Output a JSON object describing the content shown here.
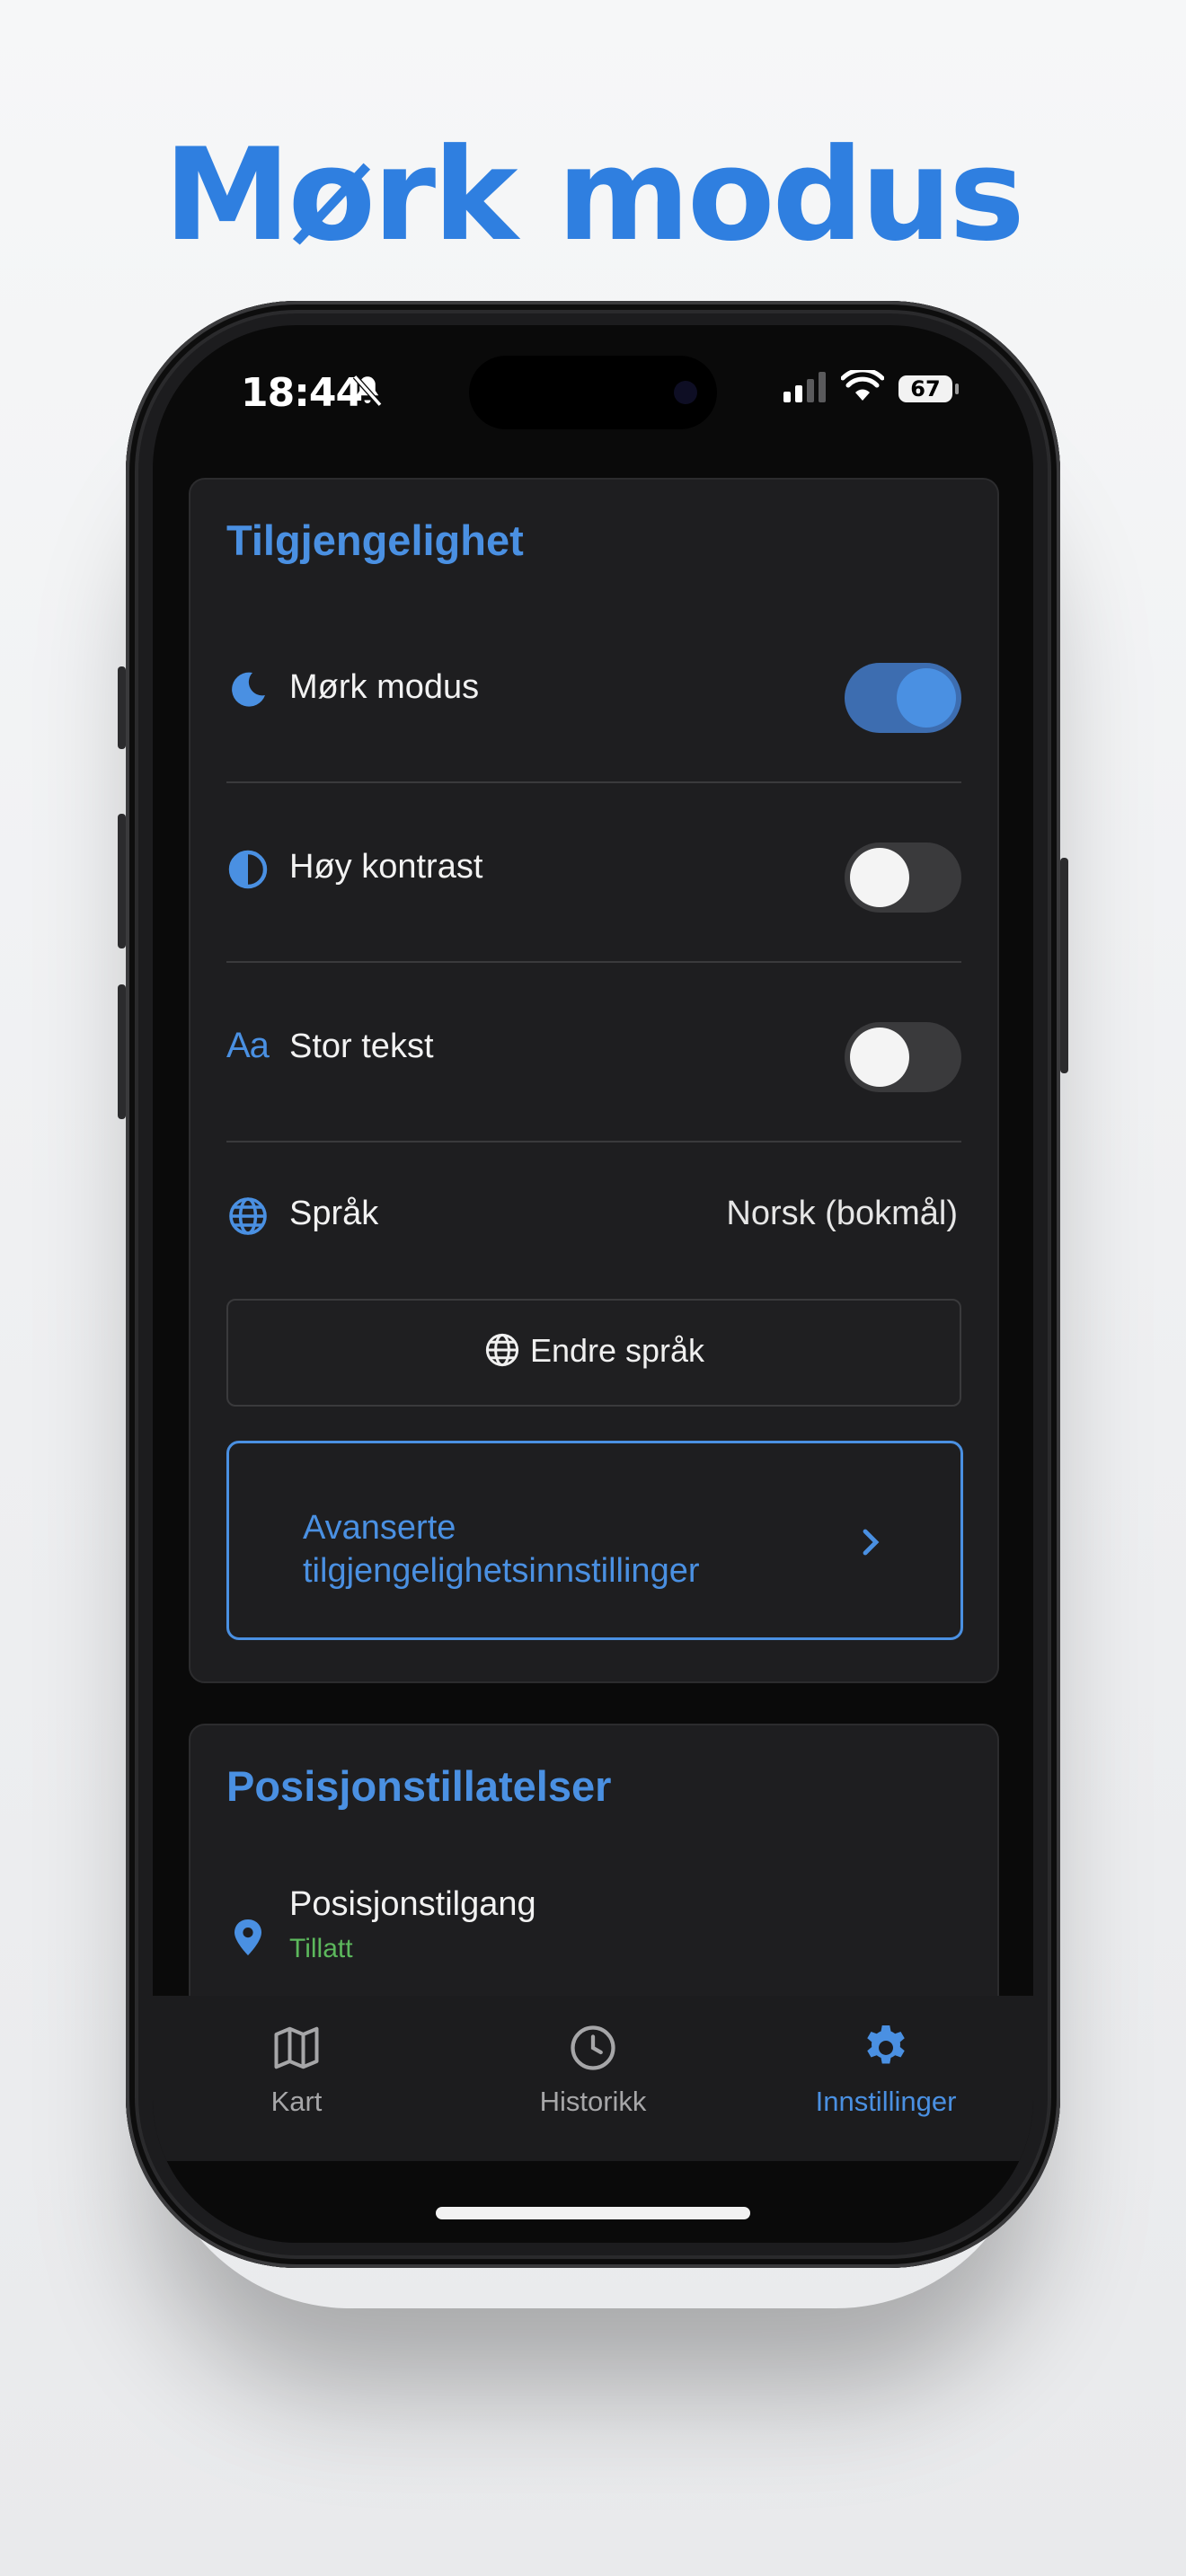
{
  "headline": "Mørk modus",
  "status_bar": {
    "time": "18:44",
    "battery": "67"
  },
  "accessibility": {
    "title": "Tilgjengelighet",
    "dark_mode": {
      "label": "Mørk modus",
      "on": true
    },
    "high_contrast": {
      "label": "Høy kontrast",
      "on": false
    },
    "large_text": {
      "label": "Stor tekst",
      "icon_text": "Aa",
      "on": false
    },
    "language": {
      "label": "Språk",
      "value": "Norsk (bokmål)"
    },
    "change_language_button": "Endre språk",
    "advanced_button_line1": "Avanserte",
    "advanced_button_line2": "tilgjengelighetsinnstillinger"
  },
  "permissions": {
    "title": "Posisjonstillatelser",
    "location": {
      "label": "Posisjonstilgang",
      "status": "Tillatt"
    }
  },
  "tabs": [
    {
      "label": "Kart",
      "active": false
    },
    {
      "label": "Historikk",
      "active": false
    },
    {
      "label": "Innstillinger",
      "active": true
    }
  ],
  "colors": {
    "accent": "#4a90e2",
    "headline": "#2f7fe0",
    "allowed": "#5cb85c",
    "card": "#1e1e20"
  }
}
